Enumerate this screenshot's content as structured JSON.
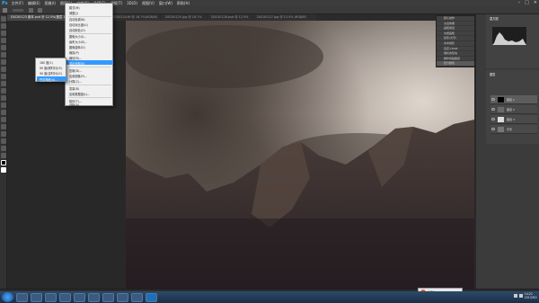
{
  "app": {
    "logo": "Ps"
  },
  "menubar": {
    "items": [
      "文件(F)",
      "编辑(E)",
      "图像(I)",
      "图层(L)",
      "文字(Y)",
      "选择(S)",
      "滤镜(T)",
      "3D(D)",
      "视图(V)",
      "窗口(W)",
      "帮助(H)"
    ],
    "window_controls": [
      "–",
      "□",
      "✕"
    ]
  },
  "tabs": [
    "DSC00123 副本.psd @ 12.5%(图层 1, RGB/8)",
    "DSC00124.tif @ 16.7%(RGB/8)",
    "DSC00125.jpg @ 16.7%",
    "DSC00126.psd @ 12.5%",
    "DSC00127.jpg @ 12.5% (RGB/8)"
  ],
  "dropdown_main": {
    "items": [
      "模式(M)",
      "调整(J)",
      "自动色调(N)",
      "自动对比度(U)",
      "自动颜色(O)",
      "图像大小(I)...",
      "画布大小(S)...",
      "图像旋转(G)",
      "裁剪(P)",
      "裁切(R)...",
      "显示全部(V)",
      "复制(D)...",
      "应用图像(Y)...",
      "计算(C)...",
      "变量(B)",
      "应用数据组(L)...",
      "陷印(T)...",
      "分析(A)"
    ],
    "shortcuts": [
      "",
      "Shift+Ctrl+L",
      "Alt+Shift+Ctrl+L",
      "Shift+Ctrl+B",
      "Alt+Ctrl+I",
      "Alt+Ctrl+C",
      "",
      "",
      "",
      "",
      "",
      "",
      "",
      "",
      "",
      "",
      "",
      ""
    ],
    "highlight_index": 7
  },
  "dropdown_sub": {
    "items": [
      "180 度(1)",
      "90 度(顺时针)(9)",
      "90 度(逆时针)(0)",
      "任意角度(A)..."
    ],
    "highlight_index": 3
  },
  "actions_panel": {
    "rows": [
      "默认动作",
      "淡出效果",
      "画框通道",
      "木质画框",
      "投影(文字)",
      "水中倒影",
      "自定义RGB",
      "熔化的铅块",
      "制作剪贴路径",
      "棕褐色调",
      "四分颜色"
    ],
    "selected_index": 10
  },
  "layers": [
    {
      "name": "图层 1"
    },
    {
      "name": "图层 2"
    },
    {
      "name": "图层 3"
    },
    {
      "name": "背景"
    }
  ],
  "panels": {
    "histogram_title": "直方图",
    "layers_title": "图层"
  },
  "colors": {
    "accent": "#3399ff",
    "ps_blue": "#31a8ff"
  },
  "taskbar": {
    "clock": "14:21",
    "date": "2013/9/1"
  },
  "notify": {
    "text": "S 中 ⁰,"
  }
}
